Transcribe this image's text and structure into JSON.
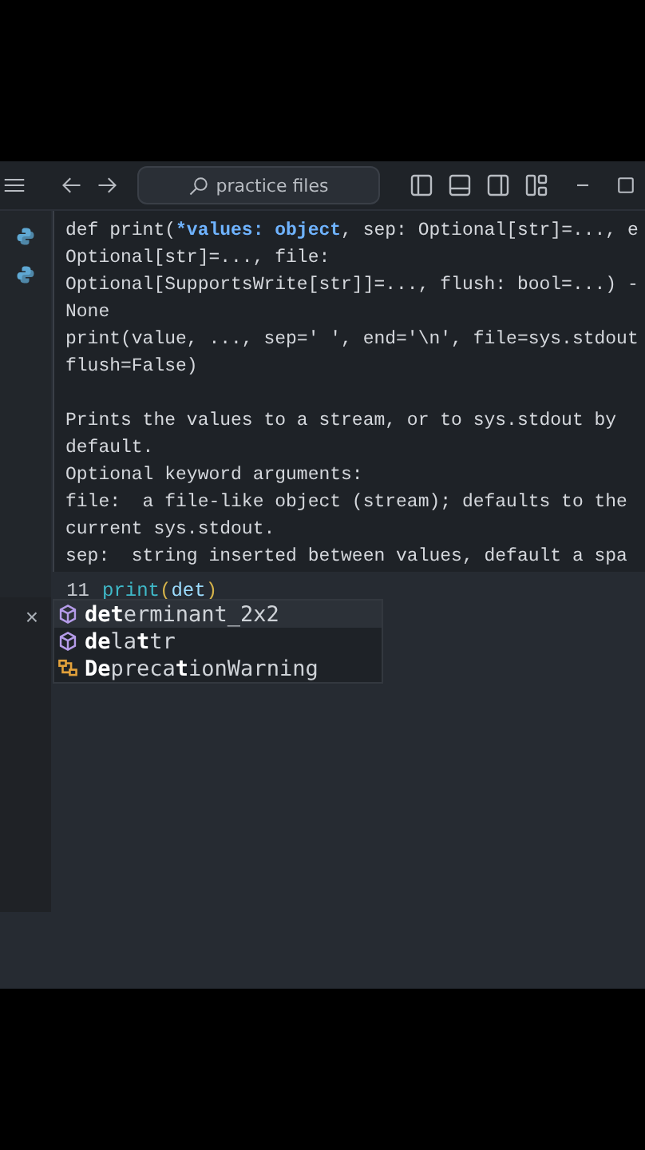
{
  "title_bar": {
    "search": {
      "value": "practice files"
    }
  },
  "hover": {
    "signature": [
      [
        {
          "text": "def print(",
          "kind": "plain"
        },
        {
          "text": "*values: object",
          "kind": "param"
        },
        {
          "text": ", sep: Optional[str]=..., e",
          "kind": "plain"
        }
      ],
      [
        {
          "text": "Optional[str]=..., file:",
          "kind": "plain"
        }
      ],
      [
        {
          "text": "Optional[SupportsWrite[str]]=..., flush: bool=...) -",
          "kind": "plain"
        }
      ],
      [
        {
          "text": "None",
          "kind": "plain"
        }
      ]
    ],
    "code": [
      "print(value, ..., sep=' ', end='\\n', file=sys.stdout",
      "flush=False)"
    ],
    "doc": [
      "Prints the values to a stream, or to sys.stdout by",
      "default.",
      "Optional keyword arguments:",
      "file:  a file-like object (stream); defaults to the",
      "current sys.stdout.",
      "sep:  string inserted between values, default a spa"
    ]
  },
  "editor": {
    "line_number": "11",
    "code": [
      {
        "text": "print",
        "kind": "function"
      },
      {
        "text": "(",
        "kind": "bracket"
      },
      {
        "text": "det",
        "kind": "plain"
      },
      {
        "text": ")",
        "kind": "bracket"
      }
    ]
  },
  "close_glyph": "×",
  "suggestions": [
    {
      "label": "**det**erminant_2x2",
      "kind": "function",
      "selected": true
    },
    {
      "label": "**de**la**t**tr",
      "kind": "function",
      "selected": false
    },
    {
      "label": "**De**preca**t**ionWarning",
      "kind": "class",
      "selected": false
    }
  ]
}
